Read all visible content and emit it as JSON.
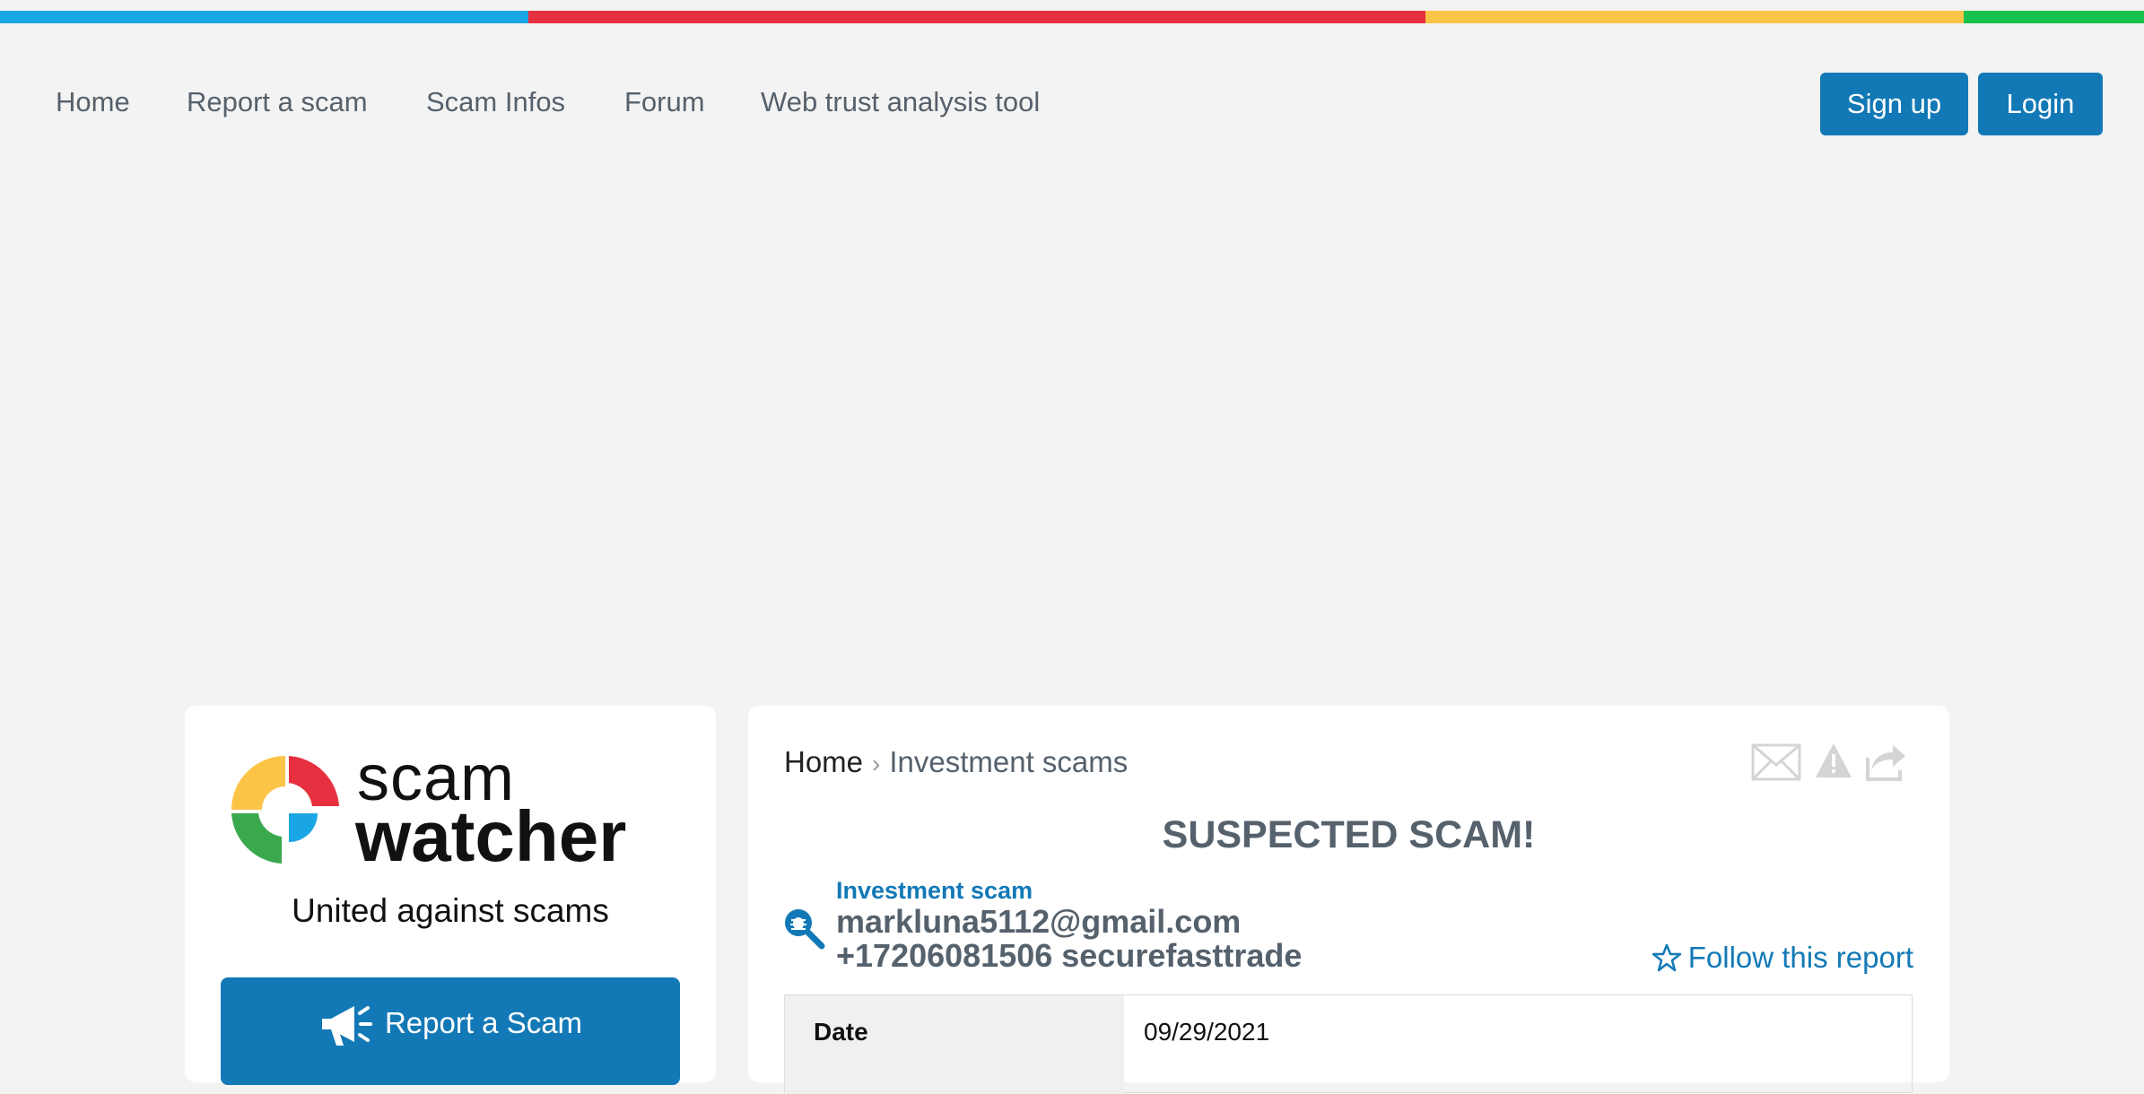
{
  "colors": {
    "stripe": [
      "#1aa6e4",
      "#e7303f",
      "#fbc447",
      "#19c24d"
    ],
    "accent": "#1279b6"
  },
  "nav": {
    "items": [
      "Home",
      "Report a scam",
      "Scam Infos",
      "Forum",
      "Web trust analysis tool"
    ],
    "signup_label": "Sign up",
    "login_label": "Login"
  },
  "sidebar": {
    "logo_word1": "scam",
    "logo_word2": "watcher",
    "tagline": "United against scams",
    "report_button": "Report a Scam"
  },
  "breadcrumb": {
    "home": "Home",
    "separator": "›",
    "category": "Investment scams"
  },
  "report": {
    "title": "SUSPECTED SCAM!",
    "category": "Investment scam",
    "subject_line1": "markluna5112@gmail.com",
    "subject_line2": "+17206081506 securefasttrade",
    "follow_label": "Follow this report",
    "icons": [
      "envelope-icon",
      "warning-icon",
      "share-icon",
      "bug-search-icon",
      "star-icon",
      "megaphone-icon"
    ]
  },
  "details": {
    "rows": [
      {
        "label": "Date",
        "value": "09/29/2021"
      }
    ]
  }
}
